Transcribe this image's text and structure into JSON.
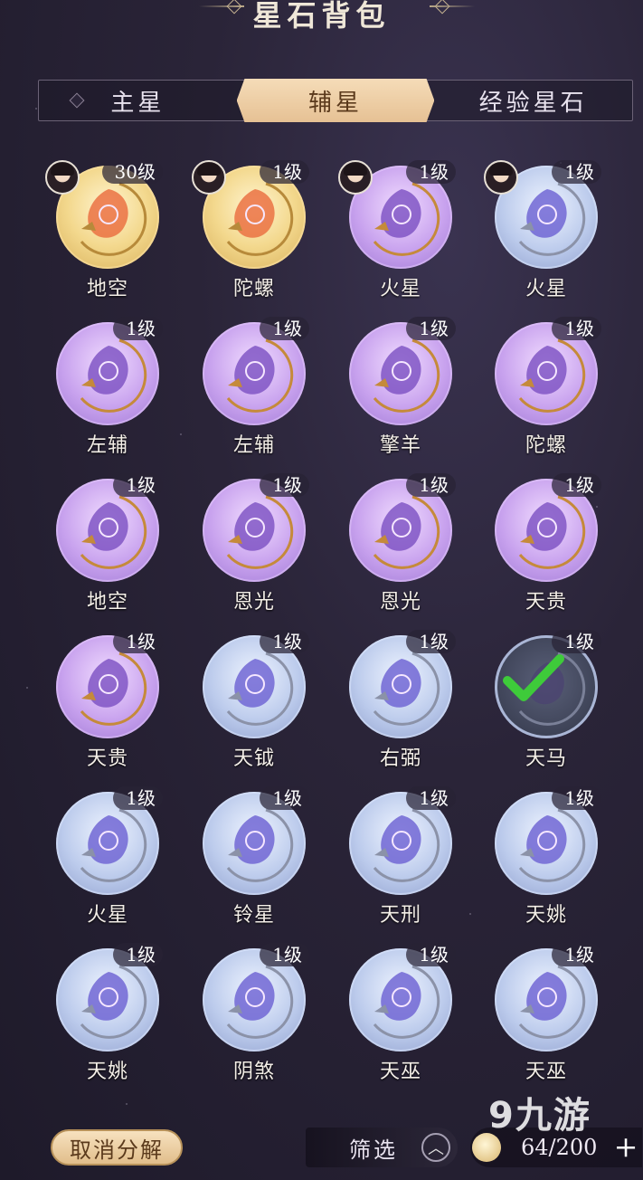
{
  "header": {
    "title": "星石背包"
  },
  "tabs": [
    {
      "label": "主星",
      "active": false
    },
    {
      "label": "辅星",
      "active": true
    },
    {
      "label": "经验星石",
      "active": false
    }
  ],
  "items": [
    {
      "name": "地空",
      "level": "30级",
      "tone": "gold",
      "has_avatar": true,
      "selected": false
    },
    {
      "name": "陀螺",
      "level": "1级",
      "tone": "gold",
      "has_avatar": true,
      "selected": false
    },
    {
      "name": "火星",
      "level": "1级",
      "tone": "purple",
      "has_avatar": true,
      "selected": false
    },
    {
      "name": "火星",
      "level": "1级",
      "tone": "blue",
      "has_avatar": true,
      "selected": false
    },
    {
      "name": "左辅",
      "level": "1级",
      "tone": "purple",
      "has_avatar": false,
      "selected": false
    },
    {
      "name": "左辅",
      "level": "1级",
      "tone": "purple",
      "has_avatar": false,
      "selected": false
    },
    {
      "name": "擎羊",
      "level": "1级",
      "tone": "purple",
      "has_avatar": false,
      "selected": false
    },
    {
      "name": "陀螺",
      "level": "1级",
      "tone": "purple",
      "has_avatar": false,
      "selected": false
    },
    {
      "name": "地空",
      "level": "1级",
      "tone": "purple",
      "has_avatar": false,
      "selected": false
    },
    {
      "name": "恩光",
      "level": "1级",
      "tone": "purple",
      "has_avatar": false,
      "selected": false
    },
    {
      "name": "恩光",
      "level": "1级",
      "tone": "purple",
      "has_avatar": false,
      "selected": false
    },
    {
      "name": "天贵",
      "level": "1级",
      "tone": "purple",
      "has_avatar": false,
      "selected": false
    },
    {
      "name": "天贵",
      "level": "1级",
      "tone": "purple",
      "has_avatar": false,
      "selected": false
    },
    {
      "name": "天钺",
      "level": "1级",
      "tone": "blue",
      "has_avatar": false,
      "selected": false
    },
    {
      "name": "右弼",
      "level": "1级",
      "tone": "blue",
      "has_avatar": false,
      "selected": false
    },
    {
      "name": "天马",
      "level": "1级",
      "tone": "blue",
      "has_avatar": false,
      "selected": true
    },
    {
      "name": "火星",
      "level": "1级",
      "tone": "blue",
      "has_avatar": false,
      "selected": false
    },
    {
      "name": "铃星",
      "level": "1级",
      "tone": "blue",
      "has_avatar": false,
      "selected": false
    },
    {
      "name": "天刑",
      "level": "1级",
      "tone": "blue",
      "has_avatar": false,
      "selected": false
    },
    {
      "name": "天姚",
      "level": "1级",
      "tone": "blue",
      "has_avatar": false,
      "selected": false
    },
    {
      "name": "天姚",
      "level": "1级",
      "tone": "blue",
      "has_avatar": false,
      "selected": false
    },
    {
      "name": "阴煞",
      "level": "1级",
      "tone": "blue",
      "has_avatar": false,
      "selected": false
    },
    {
      "name": "天巫",
      "level": "1级",
      "tone": "blue",
      "has_avatar": false,
      "selected": false
    },
    {
      "name": "天巫",
      "level": "1级",
      "tone": "blue",
      "has_avatar": false,
      "selected": false
    }
  ],
  "footer": {
    "cancel_label": "取消分解",
    "filter_label": "筛选",
    "capacity_text": "64/200",
    "plus_label": "+"
  },
  "watermark": "9九游",
  "icons": {
    "filter_toggle": "chevron-up-icon",
    "capacity": "star-stone-icon",
    "selected": "checkmark-icon"
  },
  "colors": {
    "gold_orb": "#f3d88d",
    "purple_orb": "#c8a2ee",
    "blue_orb": "#bccbec",
    "check_green": "#3ecb3a",
    "tab_active": "#f5dcb8"
  }
}
